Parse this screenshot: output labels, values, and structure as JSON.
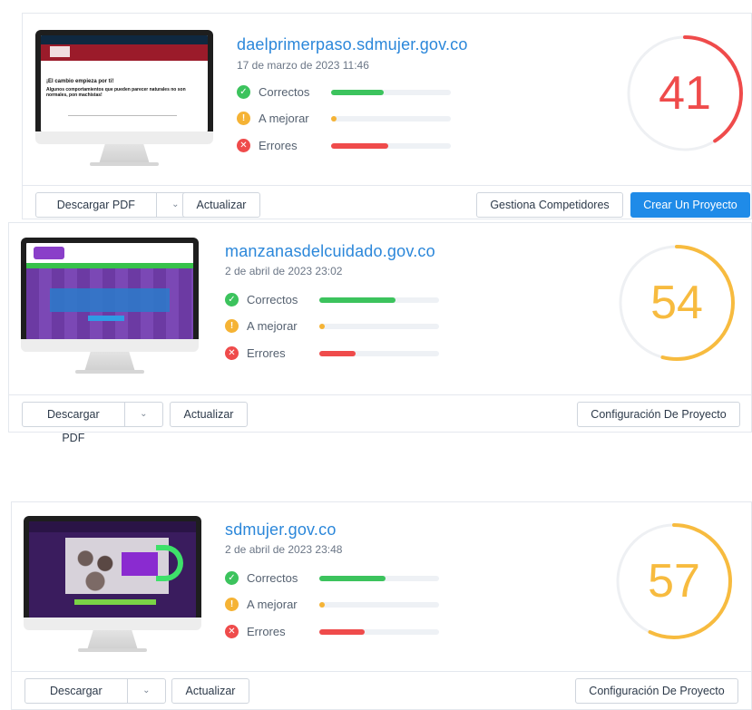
{
  "cards": [
    {
      "site": "daelprimerpaso.sdmujer.gov.co",
      "date": "17 de marzo de 2023 11:46",
      "score": "41",
      "score_value": 41,
      "score_color": "#ef4b4b",
      "metrics": [
        {
          "label": "Correctos",
          "icon": "check-icon",
          "color": "#3cc35d",
          "fraction": 0.44
        },
        {
          "label": "A mejorar",
          "icon": "exclamation-icon",
          "color": "#f5b335",
          "fraction": 0.04
        },
        {
          "label": "Errores",
          "icon": "x-icon",
          "color": "#ef4b4b",
          "fraction": 0.48
        }
      ],
      "thumb_title": "¡El cambio empieza por ti!",
      "thumb_text": "Algunos comportamientos que pueden parecer naturales no son normales, pon machistas!",
      "buttons": {
        "download": "Descargar PDF",
        "update": "Actualizar",
        "competitors": "Gestiona Competidores",
        "create": "Crear Un Proyecto"
      }
    },
    {
      "site": "manzanasdelcuidado.gov.co",
      "date": "2 de abril de 2023 23:02",
      "score": "54",
      "score_value": 54,
      "score_color": "#f7bb3f",
      "metrics": [
        {
          "label": "Correctos",
          "icon": "check-icon",
          "color": "#3cc35d",
          "fraction": 0.64
        },
        {
          "label": "A mejorar",
          "icon": "exclamation-icon",
          "color": "#f5b335",
          "fraction": 0.04
        },
        {
          "label": "Errores",
          "icon": "x-icon",
          "color": "#ef4b4b",
          "fraction": 0.3
        }
      ],
      "buttons": {
        "download": "Descargar PDF",
        "update": "Actualizar",
        "config": "Configuración De Proyecto"
      }
    },
    {
      "site": "sdmujer.gov.co",
      "date": "2 de abril de 2023 23:48",
      "score": "57",
      "score_value": 57,
      "score_color": "#f7bb3f",
      "metrics": [
        {
          "label": "Correctos",
          "icon": "check-icon",
          "color": "#3cc35d",
          "fraction": 0.55
        },
        {
          "label": "A mejorar",
          "icon": "exclamation-icon",
          "color": "#f5b335",
          "fraction": 0.04
        },
        {
          "label": "Errores",
          "icon": "x-icon",
          "color": "#ef4b4b",
          "fraction": 0.38
        }
      ],
      "buttons": {
        "download": "Descargar PDF",
        "update": "Actualizar",
        "config": "Configuración De Proyecto"
      }
    }
  ]
}
